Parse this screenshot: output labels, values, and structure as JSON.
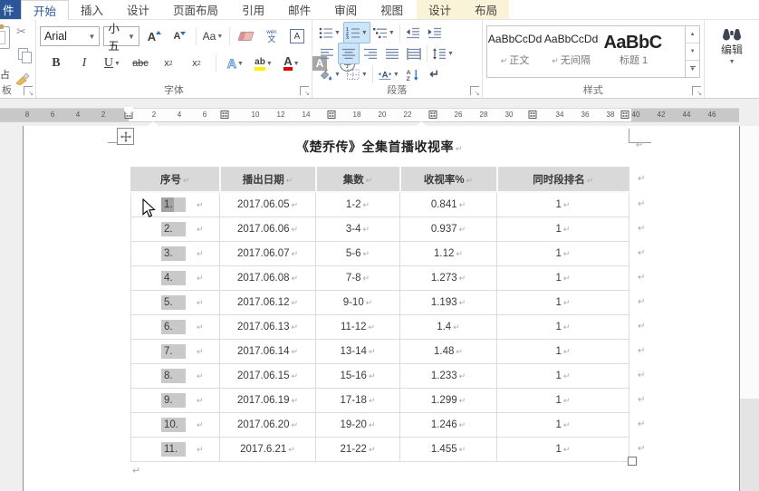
{
  "tab_bar": {
    "file_label": "件",
    "tabs": [
      {
        "label": "开始",
        "state": "active"
      },
      {
        "label": "插入",
        "state": "normal"
      },
      {
        "label": "设计",
        "state": "normal"
      },
      {
        "label": "页面布局",
        "state": "normal"
      },
      {
        "label": "引用",
        "state": "normal"
      },
      {
        "label": "邮件",
        "state": "normal"
      },
      {
        "label": "审阅",
        "state": "normal"
      },
      {
        "label": "视图",
        "state": "normal"
      }
    ],
    "contextual_tabs": [
      {
        "label": "设计"
      },
      {
        "label": "布局"
      }
    ]
  },
  "ribbon": {
    "clipboard": {
      "group_label": "板",
      "paste_partial_label": "占"
    },
    "font": {
      "group_label": "字体",
      "font_name_value": "Arial",
      "font_size_value": "小五",
      "buttons": {
        "grow_font": "A",
        "shrink_font": "A",
        "change_case": "Aa",
        "phonetic_top": "wén",
        "phonetic_bottom": "文",
        "char_border": "A",
        "bold": "B",
        "italic": "I",
        "underline": "U",
        "strikethrough": "abc",
        "subscript_x": "x",
        "subscript_n": "2",
        "superscript_x": "x",
        "superscript_n": "2",
        "text_effects": "A",
        "highlight": "ab",
        "font_color": "A",
        "char_shading": "A",
        "enclose_chars": "字"
      }
    },
    "paragraph": {
      "group_label": "段落",
      "scale_letter": "A",
      "sort_top": "A",
      "sort_bottom": "Z",
      "pilcrow_glyph": "↵"
    },
    "styles": {
      "group_label": "样式",
      "items": [
        {
          "preview": "AaBbCcDd",
          "pilcrow": "↵",
          "name": "正文"
        },
        {
          "preview": "AaBbCcDd",
          "pilcrow": "↵",
          "name": "无间隔"
        },
        {
          "preview": "AaBbC",
          "pilcrow": "",
          "name": "标题 1"
        }
      ]
    },
    "editing": {
      "button_label": "编辑"
    }
  },
  "ruler": {
    "left_numbers": [
      8,
      6,
      4,
      2
    ],
    "center_numbers": [
      2,
      4,
      6,
      10,
      12,
      14,
      18,
      20,
      22,
      26,
      28,
      30,
      34,
      36,
      38
    ],
    "right_numbers": [
      40,
      42,
      44,
      46
    ]
  },
  "document": {
    "title": "《楚乔传》全集首播收视率",
    "pilcrow": "↵",
    "table": {
      "headers": [
        "序号",
        "播出日期",
        "集数",
        "收视率%",
        "同时段排名"
      ],
      "rows": [
        {
          "no": "1.",
          "date": "2017.06.05",
          "episodes": "1-2",
          "rating": "0.841",
          "rank": "1"
        },
        {
          "no": "2.",
          "date": "2017.06.06",
          "episodes": "3-4",
          "rating": "0.937",
          "rank": "1"
        },
        {
          "no": "3.",
          "date": "2017.06.07",
          "episodes": "5-6",
          "rating": "1.12",
          "rank": "1"
        },
        {
          "no": "4.",
          "date": "2017.06.08",
          "episodes": "7-8",
          "rating": "1.273",
          "rank": "1"
        },
        {
          "no": "5.",
          "date": "2017.06.12",
          "episodes": "9-10",
          "rating": "1.193",
          "rank": "1"
        },
        {
          "no": "6.",
          "date": "2017.06.13",
          "episodes": "11-12",
          "rating": "1.4",
          "rank": "1"
        },
        {
          "no": "7.",
          "date": "2017.06.14",
          "episodes": "13-14",
          "rating": "1.48",
          "rank": "1"
        },
        {
          "no": "8.",
          "date": "2017.06.15",
          "episodes": "15-16",
          "rating": "1.233",
          "rank": "1"
        },
        {
          "no": "9.",
          "date": "2017.06.19",
          "episodes": "17-18",
          "rating": "1.299",
          "rank": "1"
        },
        {
          "no": "10.",
          "date": "2017.06.20",
          "episodes": "19-20",
          "rating": "1.246",
          "rank": "1"
        },
        {
          "no": "11.",
          "date": "2017.6.21",
          "episodes": "21-22",
          "rating": "1.455",
          "rank": "1"
        }
      ]
    }
  },
  "colors": {
    "accent_blue": "#2b579a",
    "button_active_fill": "#cde6f7",
    "table_header_fill": "#d9d9d9",
    "field_shading_gray": "#c9c9c9",
    "highlight_yellow": "#fff200",
    "font_color_red": "#e00000",
    "contextual_tab_fill": "#fbf3d7"
  }
}
